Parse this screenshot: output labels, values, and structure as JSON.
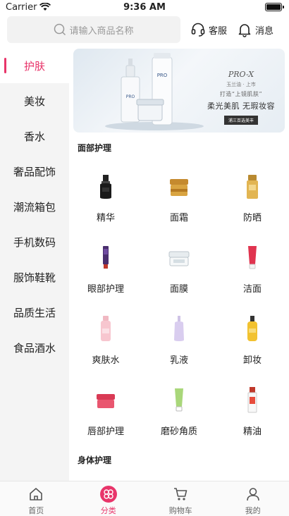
{
  "status_bar": {
    "carrier": "Carrier",
    "time": "9:36 AM"
  },
  "search": {
    "placeholder": "请输入商品名称"
  },
  "header": {
    "service_label": "客服",
    "message_label": "消息"
  },
  "sidebar": {
    "items": [
      {
        "label": "护肤",
        "active": true
      },
      {
        "label": "美妆"
      },
      {
        "label": "香水"
      },
      {
        "label": "奢品配饰"
      },
      {
        "label": "潮流箱包"
      },
      {
        "label": "手机数码"
      },
      {
        "label": "服饰鞋靴"
      },
      {
        "label": "品质生活"
      },
      {
        "label": "食品酒水"
      }
    ]
  },
  "banner": {
    "brand": "PRO-X",
    "sub": "玉兰油 · 上市",
    "headline": "打造“上镜肌肤”",
    "tagline": "柔光美肌 无瑕妆容",
    "button": "浦三百选美丰"
  },
  "sections": [
    {
      "title": "面部护理",
      "products": [
        {
          "label": "精华",
          "icon": "serum-bottle-icon"
        },
        {
          "label": "面霜",
          "icon": "cream-jar-icon"
        },
        {
          "label": "防晒",
          "icon": "sunscreen-icon"
        },
        {
          "label": "眼部护理",
          "icon": "eye-cream-tube-icon"
        },
        {
          "label": "面膜",
          "icon": "face-mask-jar-icon"
        },
        {
          "label": "洁面",
          "icon": "cleanser-tube-icon"
        },
        {
          "label": "爽肤水",
          "icon": "toner-bottle-icon"
        },
        {
          "label": "乳液",
          "icon": "lotion-bottle-icon"
        },
        {
          "label": "卸妆",
          "icon": "cleansing-oil-icon"
        },
        {
          "label": "唇部护理",
          "icon": "lip-mask-jar-icon"
        },
        {
          "label": "磨砂角质",
          "icon": "scrub-tube-icon"
        },
        {
          "label": "精油",
          "icon": "essence-oil-bottle-icon"
        }
      ]
    },
    {
      "title": "身体护理",
      "products": []
    }
  ],
  "tabbar": {
    "tabs": [
      {
        "label": "首页",
        "icon": "home-icon"
      },
      {
        "label": "分类",
        "icon": "category-flower-icon",
        "active": true
      },
      {
        "label": "购物车",
        "icon": "cart-icon"
      },
      {
        "label": "我的",
        "icon": "user-icon"
      }
    ]
  },
  "colors": {
    "accent": "#e8356a",
    "sidebar_bg": "#f4f4f4",
    "search_bg": "#f2f2f2"
  }
}
